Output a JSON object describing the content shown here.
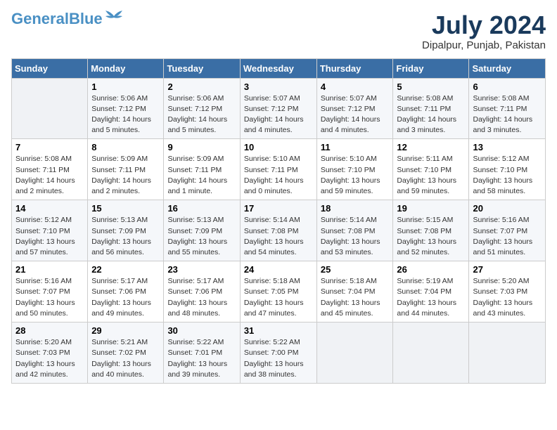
{
  "header": {
    "logo_general": "General",
    "logo_blue": "Blue",
    "month_title": "July 2024",
    "location": "Dipalpur, Punjab, Pakistan"
  },
  "weekdays": [
    "Sunday",
    "Monday",
    "Tuesday",
    "Wednesday",
    "Thursday",
    "Friday",
    "Saturday"
  ],
  "weeks": [
    [
      {
        "day": "",
        "sunrise": "",
        "sunset": "",
        "daylight": ""
      },
      {
        "day": "1",
        "sunrise": "Sunrise: 5:06 AM",
        "sunset": "Sunset: 7:12 PM",
        "daylight": "Daylight: 14 hours and 5 minutes."
      },
      {
        "day": "2",
        "sunrise": "Sunrise: 5:06 AM",
        "sunset": "Sunset: 7:12 PM",
        "daylight": "Daylight: 14 hours and 5 minutes."
      },
      {
        "day": "3",
        "sunrise": "Sunrise: 5:07 AM",
        "sunset": "Sunset: 7:12 PM",
        "daylight": "Daylight: 14 hours and 4 minutes."
      },
      {
        "day": "4",
        "sunrise": "Sunrise: 5:07 AM",
        "sunset": "Sunset: 7:12 PM",
        "daylight": "Daylight: 14 hours and 4 minutes."
      },
      {
        "day": "5",
        "sunrise": "Sunrise: 5:08 AM",
        "sunset": "Sunset: 7:11 PM",
        "daylight": "Daylight: 14 hours and 3 minutes."
      },
      {
        "day": "6",
        "sunrise": "Sunrise: 5:08 AM",
        "sunset": "Sunset: 7:11 PM",
        "daylight": "Daylight: 14 hours and 3 minutes."
      }
    ],
    [
      {
        "day": "7",
        "sunrise": "Sunrise: 5:08 AM",
        "sunset": "Sunset: 7:11 PM",
        "daylight": "Daylight: 14 hours and 2 minutes."
      },
      {
        "day": "8",
        "sunrise": "Sunrise: 5:09 AM",
        "sunset": "Sunset: 7:11 PM",
        "daylight": "Daylight: 14 hours and 2 minutes."
      },
      {
        "day": "9",
        "sunrise": "Sunrise: 5:09 AM",
        "sunset": "Sunset: 7:11 PM",
        "daylight": "Daylight: 14 hours and 1 minute."
      },
      {
        "day": "10",
        "sunrise": "Sunrise: 5:10 AM",
        "sunset": "Sunset: 7:11 PM",
        "daylight": "Daylight: 14 hours and 0 minutes."
      },
      {
        "day": "11",
        "sunrise": "Sunrise: 5:10 AM",
        "sunset": "Sunset: 7:10 PM",
        "daylight": "Daylight: 13 hours and 59 minutes."
      },
      {
        "day": "12",
        "sunrise": "Sunrise: 5:11 AM",
        "sunset": "Sunset: 7:10 PM",
        "daylight": "Daylight: 13 hours and 59 minutes."
      },
      {
        "day": "13",
        "sunrise": "Sunrise: 5:12 AM",
        "sunset": "Sunset: 7:10 PM",
        "daylight": "Daylight: 13 hours and 58 minutes."
      }
    ],
    [
      {
        "day": "14",
        "sunrise": "Sunrise: 5:12 AM",
        "sunset": "Sunset: 7:10 PM",
        "daylight": "Daylight: 13 hours and 57 minutes."
      },
      {
        "day": "15",
        "sunrise": "Sunrise: 5:13 AM",
        "sunset": "Sunset: 7:09 PM",
        "daylight": "Daylight: 13 hours and 56 minutes."
      },
      {
        "day": "16",
        "sunrise": "Sunrise: 5:13 AM",
        "sunset": "Sunset: 7:09 PM",
        "daylight": "Daylight: 13 hours and 55 minutes."
      },
      {
        "day": "17",
        "sunrise": "Sunrise: 5:14 AM",
        "sunset": "Sunset: 7:08 PM",
        "daylight": "Daylight: 13 hours and 54 minutes."
      },
      {
        "day": "18",
        "sunrise": "Sunrise: 5:14 AM",
        "sunset": "Sunset: 7:08 PM",
        "daylight": "Daylight: 13 hours and 53 minutes."
      },
      {
        "day": "19",
        "sunrise": "Sunrise: 5:15 AM",
        "sunset": "Sunset: 7:08 PM",
        "daylight": "Daylight: 13 hours and 52 minutes."
      },
      {
        "day": "20",
        "sunrise": "Sunrise: 5:16 AM",
        "sunset": "Sunset: 7:07 PM",
        "daylight": "Daylight: 13 hours and 51 minutes."
      }
    ],
    [
      {
        "day": "21",
        "sunrise": "Sunrise: 5:16 AM",
        "sunset": "Sunset: 7:07 PM",
        "daylight": "Daylight: 13 hours and 50 minutes."
      },
      {
        "day": "22",
        "sunrise": "Sunrise: 5:17 AM",
        "sunset": "Sunset: 7:06 PM",
        "daylight": "Daylight: 13 hours and 49 minutes."
      },
      {
        "day": "23",
        "sunrise": "Sunrise: 5:17 AM",
        "sunset": "Sunset: 7:06 PM",
        "daylight": "Daylight: 13 hours and 48 minutes."
      },
      {
        "day": "24",
        "sunrise": "Sunrise: 5:18 AM",
        "sunset": "Sunset: 7:05 PM",
        "daylight": "Daylight: 13 hours and 47 minutes."
      },
      {
        "day": "25",
        "sunrise": "Sunrise: 5:18 AM",
        "sunset": "Sunset: 7:04 PM",
        "daylight": "Daylight: 13 hours and 45 minutes."
      },
      {
        "day": "26",
        "sunrise": "Sunrise: 5:19 AM",
        "sunset": "Sunset: 7:04 PM",
        "daylight": "Daylight: 13 hours and 44 minutes."
      },
      {
        "day": "27",
        "sunrise": "Sunrise: 5:20 AM",
        "sunset": "Sunset: 7:03 PM",
        "daylight": "Daylight: 13 hours and 43 minutes."
      }
    ],
    [
      {
        "day": "28",
        "sunrise": "Sunrise: 5:20 AM",
        "sunset": "Sunset: 7:03 PM",
        "daylight": "Daylight: 13 hours and 42 minutes."
      },
      {
        "day": "29",
        "sunrise": "Sunrise: 5:21 AM",
        "sunset": "Sunset: 7:02 PM",
        "daylight": "Daylight: 13 hours and 40 minutes."
      },
      {
        "day": "30",
        "sunrise": "Sunrise: 5:22 AM",
        "sunset": "Sunset: 7:01 PM",
        "daylight": "Daylight: 13 hours and 39 minutes."
      },
      {
        "day": "31",
        "sunrise": "Sunrise: 5:22 AM",
        "sunset": "Sunset: 7:00 PM",
        "daylight": "Daylight: 13 hours and 38 minutes."
      },
      {
        "day": "",
        "sunrise": "",
        "sunset": "",
        "daylight": ""
      },
      {
        "day": "",
        "sunrise": "",
        "sunset": "",
        "daylight": ""
      },
      {
        "day": "",
        "sunrise": "",
        "sunset": "",
        "daylight": ""
      }
    ]
  ]
}
